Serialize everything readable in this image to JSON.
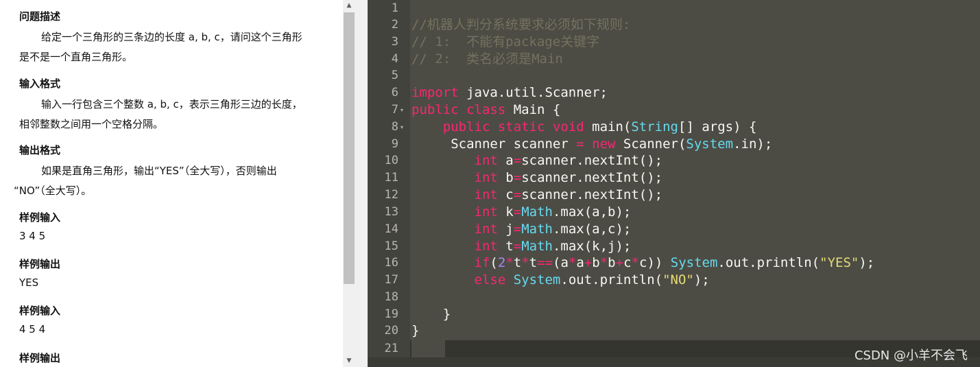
{
  "problem": {
    "sections": [
      {
        "heading": "问题描述",
        "lines": [
          "给定一个三角形的三条边的长度 a, b, c，请问这个三角形",
          "是不是一个直角三角形。"
        ]
      },
      {
        "heading": "输入格式",
        "lines": [
          "输入一行包含三个整数 a, b, c，表示三角形三边的长度，",
          "相邻整数之间用一个空格分隔。"
        ]
      },
      {
        "heading": "输出格式",
        "lines": [
          "如果是直角三角形，输出“YES”（全大写），否则输出",
          "“NO”（全大写）。"
        ]
      },
      {
        "heading": "样例输入",
        "lines": [
          "3 4 5"
        ]
      },
      {
        "heading": "样例输出",
        "lines": [
          "YES"
        ]
      },
      {
        "heading": "样例输入",
        "lines": [
          "4 5 4"
        ]
      },
      {
        "heading": "样例输出",
        "lines": []
      }
    ],
    "scroll_up_glyph": "▲",
    "scroll_down_glyph": "▼"
  },
  "editor": {
    "line_numbers": [
      "1",
      "2",
      "3",
      "4",
      "5",
      "6",
      "7",
      "8",
      "9",
      "10",
      "11",
      "12",
      "13",
      "14",
      "15",
      "16",
      "17",
      "18",
      "19",
      "20",
      "21"
    ],
    "fold_glyph": "▾",
    "code": {
      "l2": "//机器人判分系统要求必须如下规则:",
      "l3": "// 1:  不能有package关键字",
      "l4": "// 2:  类名必须是Main",
      "l6_kw": "import",
      "l6_rest": " java.util.Scanner;",
      "l7_kw1": "public",
      "l7_kw2": "class",
      "l7_rest": " Main {",
      "l8_indent": "    ",
      "l8_kw1": "public",
      "l8_kw2": "static",
      "l8_kw3": "void",
      "l8_name": " main(",
      "l8_type": "String",
      "l8_rest": "[] args) {",
      "l9_indent": "     ",
      "l9_a": "Scanner scanner ",
      "l9_eq": "=",
      "l9_new": "new",
      "l9_b": " Scanner(",
      "l9_sys": "System",
      "l9_c": ".in);",
      "int_kw": "int",
      "indent8": "        ",
      "l10_a": " a",
      "l10_b": "scanner.nextInt();",
      "l11_a": " b",
      "l12_a": " c",
      "l13_a": " k",
      "l13_b": ".max(a,b);",
      "l14_a": " j",
      "l14_b": ".max(a,c);",
      "l15_a": " t",
      "l15_b": ".max(k,j);",
      "math": "Math",
      "eq": "=",
      "if_kw": "if",
      "l16_p1": "(",
      "l16_two": "2",
      "star": "*",
      "plus": "+",
      "eqeq": "==",
      "l16_t": "t",
      "l16_pa": "(a",
      "l16_a": "a",
      "l16_b": "b",
      "l16_c": "c",
      "l16_close": ")) ",
      "sys": "System",
      "println": ".out.println(",
      "yes": "\"YES\"",
      "no": "\"NO\"",
      "end": ");",
      "else_kw": "else",
      "l19": "    }",
      "l20": "}"
    },
    "watermark": "CSDN @小羊不会飞"
  },
  "colors": {
    "editor_bg": "#4c4c45",
    "comment": "#75715e",
    "keyword": "#f92672",
    "type": "#66d9ef",
    "string": "#e6db74",
    "number": "#ae81ff"
  }
}
